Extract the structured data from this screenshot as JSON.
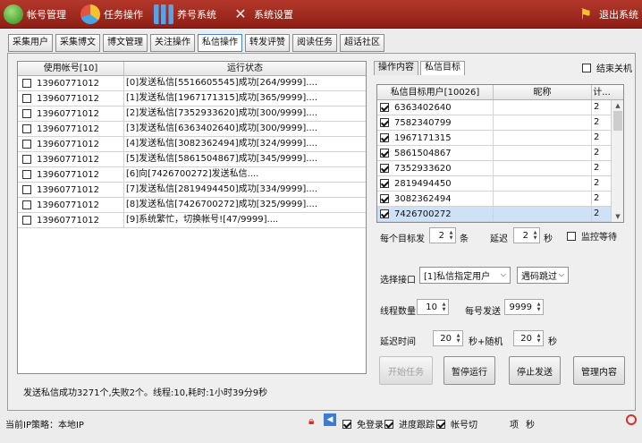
{
  "nav": {
    "account_mgmt": "帐号管理",
    "task_ops": "任务操作",
    "nurture_system": "养号系统",
    "system_settings": "系统设置",
    "exit_system": "退出系统"
  },
  "tabs": [
    "采集用户",
    "采集博文",
    "博文管理",
    "关注操作",
    "私信操作",
    "转发评赞",
    "阅读任务",
    "超话社区"
  ],
  "active_tab": "私信操作",
  "left_grid": {
    "headers": [
      "使用帐号[10]",
      "运行状态"
    ],
    "rows": [
      {
        "account": "13960771012",
        "status": "[0]发送私信[5516605545]成功[264/9999]....",
        "checked": false
      },
      {
        "account": "13960771012",
        "status": "[1]发送私信[1967171315]成功[365/9999]....",
        "checked": false
      },
      {
        "account": "13960771012",
        "status": "[2]发送私信[7352933620]成功[300/9999]....",
        "checked": false
      },
      {
        "account": "13960771012",
        "status": "[3]发送私信[6363402640]成功[300/9999]....",
        "checked": false
      },
      {
        "account": "13960771012",
        "status": "[4]发送私信[3082362494]成功[324/9999]....",
        "checked": false
      },
      {
        "account": "13960771012",
        "status": "[5]发送私信[5861504867]成功[345/9999]....",
        "checked": false
      },
      {
        "account": "13960771012",
        "status": "[6]向[7426700272]发送私信....",
        "checked": false
      },
      {
        "account": "13960771012",
        "status": "[7]发送私信[2819494450]成功[334/9999]....",
        "checked": false
      },
      {
        "account": "13960771012",
        "status": "[8]发送私信[7426700272]成功[325/9999]....",
        "checked": false
      },
      {
        "account": "13960771012",
        "status": "[9]系统繁忙，切换帐号![47/9999]....",
        "checked": false
      }
    ]
  },
  "status_line": "发送私信成功3271个,失败2个。线程:10,耗时:1小时39分9秒",
  "right_tabs": [
    "操作内容",
    "私信目标"
  ],
  "right_active_tab": "私信目标",
  "shutdown_label": "结束关机",
  "target_grid": {
    "headers": [
      "私信目标用户[10026]",
      "昵称",
      "计..."
    ],
    "rows": [
      {
        "user": "6363402640",
        "nick": "",
        "count": "2",
        "checked": true
      },
      {
        "user": "7582340799",
        "nick": "",
        "count": "2",
        "checked": true
      },
      {
        "user": "1967171315",
        "nick": "",
        "count": "2",
        "checked": true
      },
      {
        "user": "5861504867",
        "nick": "",
        "count": "2",
        "checked": true
      },
      {
        "user": "7352933620",
        "nick": "",
        "count": "2",
        "checked": true
      },
      {
        "user": "2819494450",
        "nick": "",
        "count": "2",
        "checked": true
      },
      {
        "user": "3082362494",
        "nick": "",
        "count": "2",
        "checked": true
      },
      {
        "user": "7426700272",
        "nick": "",
        "count": "2",
        "checked": true,
        "selected": true
      }
    ]
  },
  "per_target": {
    "label": "每个目标发",
    "value": "2",
    "unit": "条"
  },
  "delay": {
    "label": "延迟",
    "value": "2",
    "unit": "秒"
  },
  "monitor_wait_label": "监控等待",
  "interface": {
    "label": "选择接口",
    "value": "[1]私信指定用户"
  },
  "captcha": {
    "value": "遇码跳过"
  },
  "threads": {
    "label": "线程数量",
    "value": "10"
  },
  "per_account": {
    "label": "每号发送",
    "value": "9999"
  },
  "delay_time": {
    "label": "延迟时间",
    "value": "20",
    "mid": "秒+随机",
    "value2": "20",
    "unit": "秒"
  },
  "buttons": {
    "start": "开始任务",
    "pause": "暂停运行",
    "stop": "停止发送",
    "manage": "管理内容"
  },
  "footer": {
    "ip_strategy": "当前IP策略：本地IP",
    "free_login": "免登录",
    "progress_track": "进度跟踪",
    "account_change": "帐号切",
    "items": "项",
    "last_label": "秒"
  },
  "colors": {
    "topbar": "#9f2b20",
    "selection": "#cfe1f6",
    "accent": "#4a84c9"
  }
}
